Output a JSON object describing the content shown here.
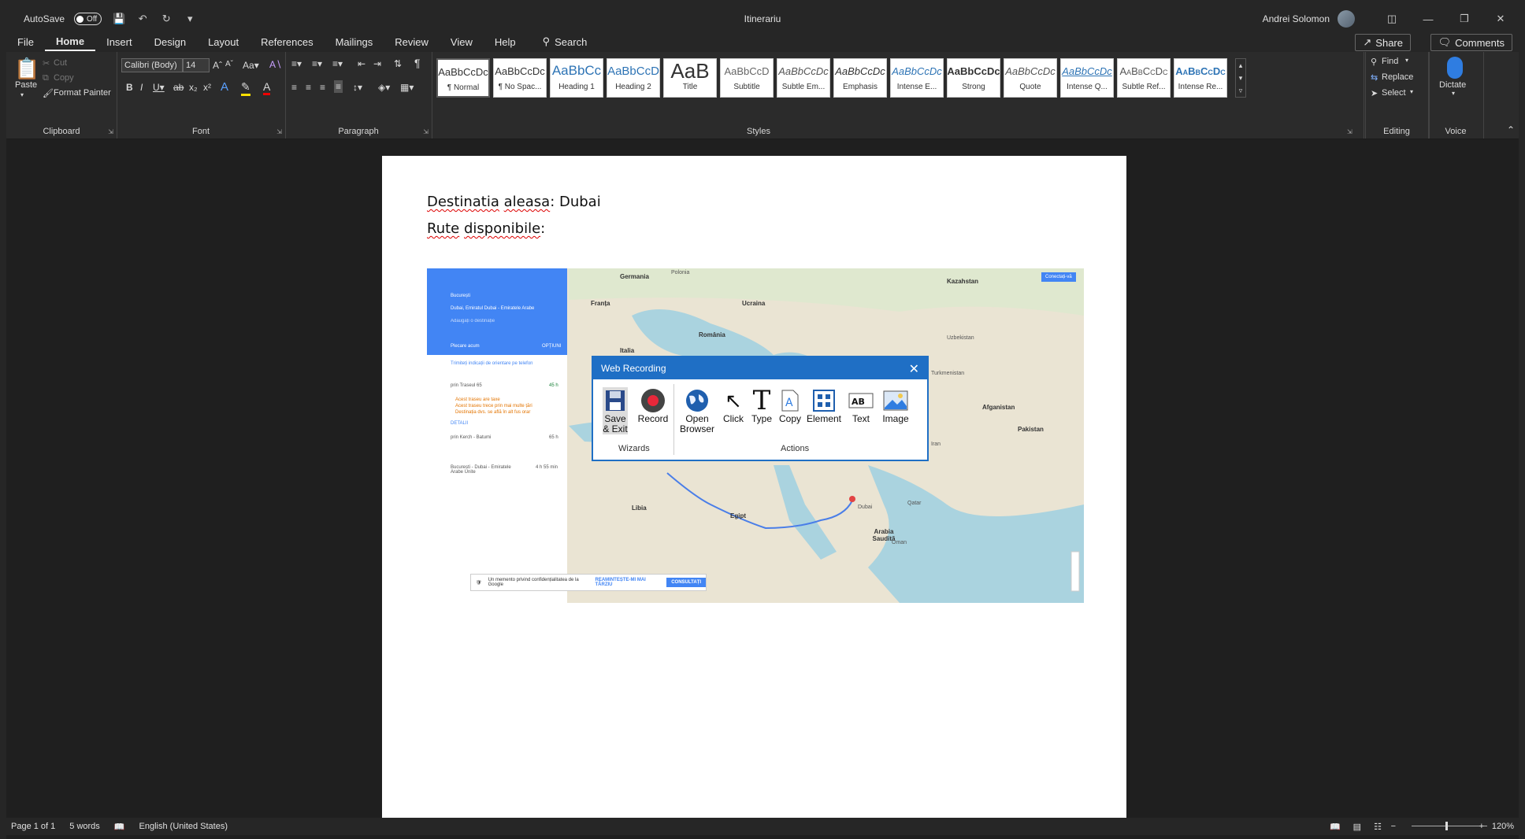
{
  "titlebar": {
    "autosave_label": "AutoSave",
    "autosave_state": "Off",
    "doc_title": "Itinerariu",
    "user_name": "Andrei Solomon"
  },
  "tabs": [
    "File",
    "Home",
    "Insert",
    "Design",
    "Layout",
    "References",
    "Mailings",
    "Review",
    "View",
    "Help"
  ],
  "search_label": "Search",
  "share_label": "Share",
  "comments_label": "Comments",
  "ribbon": {
    "clipboard": {
      "paste": "Paste",
      "cut": "Cut",
      "copy": "Copy",
      "format_painter": "Format Painter",
      "label": "Clipboard"
    },
    "font": {
      "name": "Calibri (Body)",
      "size": "14",
      "case": "Aa",
      "label": "Font"
    },
    "paragraph": {
      "label": "Paragraph"
    },
    "styles": {
      "label": "Styles",
      "items": [
        {
          "sample": "AaBbCcDc",
          "name": "¶ Normal"
        },
        {
          "sample": "AaBbCcDc",
          "name": "¶ No Spac..."
        },
        {
          "sample": "AaBbCc",
          "name": "Heading 1"
        },
        {
          "sample": "AaBbCcD",
          "name": "Heading 2"
        },
        {
          "sample": "AaB",
          "name": "Title"
        },
        {
          "sample": "AaBbCcD",
          "name": "Subtitle"
        },
        {
          "sample": "AaBbCcDc",
          "name": "Subtle Em..."
        },
        {
          "sample": "AaBbCcDc",
          "name": "Emphasis"
        },
        {
          "sample": "AaBbCcDc",
          "name": "Intense E..."
        },
        {
          "sample": "AaBbCcDc",
          "name": "Strong"
        },
        {
          "sample": "AaBbCcDc",
          "name": "Quote"
        },
        {
          "sample": "AaBbCcDc",
          "name": "Intense Q..."
        },
        {
          "sample": "AaBbCcDc",
          "name": "Subtle Ref..."
        },
        {
          "sample": "AaBbCcDc",
          "name": "Intense Re..."
        }
      ]
    },
    "editing": {
      "find": "Find",
      "replace": "Replace",
      "select": "Select",
      "label": "Editing"
    },
    "voice": {
      "dictate": "Dictate",
      "label": "Voice"
    }
  },
  "document": {
    "line1_a": "Destinatia",
    "line1_b": "aleasa",
    "line1_c": ": Dubai",
    "line2_a": "Rute",
    "line2_b": "disponibile",
    "line2_c": ":"
  },
  "map": {
    "origin": "București",
    "destination": "Dubai, Emiratul Dubai - Emiratele Arabe",
    "add_dest": "Adăugați o destinație",
    "leave_now": "Plecare acum",
    "options": "OPȚIUNI",
    "send_phone": "Trimiteți indicații de orientare pe telefon",
    "route1": "prin Traseul 65",
    "route1_time": "45 h",
    "route1_warn": [
      "Acest traseu are taxe",
      "Acest traseu trece prin mai multe țări",
      "Destinația dvs. se află în alt fus orar"
    ],
    "details": "DETALII",
    "route2": "prin Kerch - Batumi",
    "route2_time": "65 h",
    "route3": "București - Dubai - Emiratele Arabe Unite",
    "route3_time": "4 h 55 min",
    "privacy_text": "Un memento privind confidențialitatea de la Google",
    "remind_later": "REAMINTEȘTE-MI MAI TÂRZIU",
    "review_btn": "CONSULTAȚI",
    "signin": "Conectați-vă",
    "labels": [
      "Germania",
      "Polonia",
      "Ucraina",
      "Kazahstan",
      "Franța",
      "Italia",
      "România",
      "Turkmenistan",
      "Uzbekistan",
      "Afganistan",
      "Pakistan",
      "Libia",
      "Egipt",
      "Arabia Saudită",
      "Dubai",
      "Oman",
      "Iran",
      "Qatar"
    ]
  },
  "web_recording": {
    "title": "Web Recording",
    "save_exit_1": "Save",
    "save_exit_2": "& Exit",
    "record": "Record",
    "wizards": "Wizards",
    "open_browser_1": "Open",
    "open_browser_2": "Browser",
    "click": "Click",
    "type": "Type",
    "copy": "Copy",
    "element": "Element",
    "text": "Text",
    "image": "Image",
    "actions": "Actions"
  },
  "status": {
    "page": "Page 1 of 1",
    "words": "5 words",
    "language": "English (United States)",
    "zoom": "120%"
  }
}
